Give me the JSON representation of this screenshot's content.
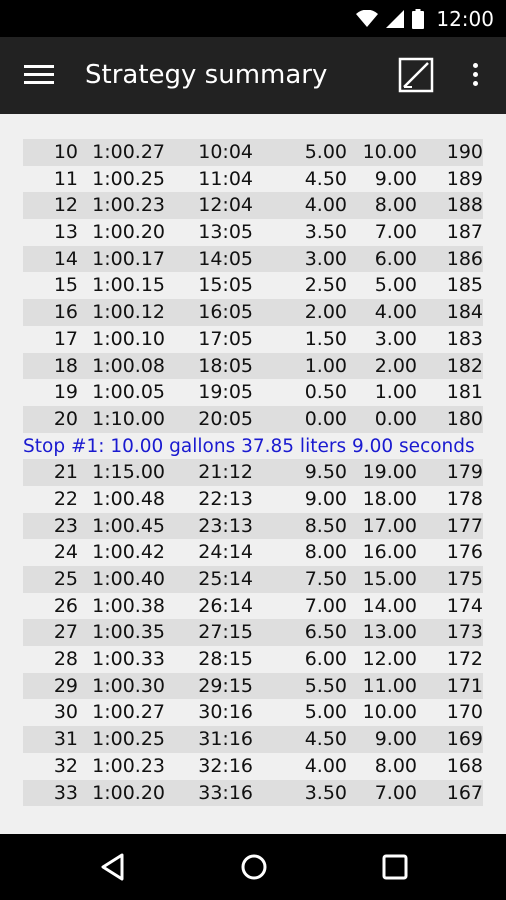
{
  "status_bar": {
    "time": "12:00"
  },
  "app_bar": {
    "title": "Strategy summary"
  },
  "table": {
    "groups": [
      {
        "rows": [
          [
            "10",
            "1:00.27",
            "10:04",
            "5.00",
            "10.00",
            "190"
          ],
          [
            "11",
            "1:00.25",
            "11:04",
            "4.50",
            "9.00",
            "189"
          ],
          [
            "12",
            "1:00.23",
            "12:04",
            "4.00",
            "8.00",
            "188"
          ],
          [
            "13",
            "1:00.20",
            "13:05",
            "3.50",
            "7.00",
            "187"
          ],
          [
            "14",
            "1:00.17",
            "14:05",
            "3.00",
            "6.00",
            "186"
          ],
          [
            "15",
            "1:00.15",
            "15:05",
            "2.50",
            "5.00",
            "185"
          ],
          [
            "16",
            "1:00.12",
            "16:05",
            "2.00",
            "4.00",
            "184"
          ],
          [
            "17",
            "1:00.10",
            "17:05",
            "1.50",
            "3.00",
            "183"
          ],
          [
            "18",
            "1:00.08",
            "18:05",
            "1.00",
            "2.00",
            "182"
          ],
          [
            "19",
            "1:00.05",
            "19:05",
            "0.50",
            "1.00",
            "181"
          ],
          [
            "20",
            "1:10.00",
            "20:05",
            "0.00",
            "0.00",
            "180"
          ]
        ]
      },
      {
        "stop_text": "Stop #1: 10.00 gallons 37.85 liters 9.00 seconds",
        "rows": [
          [
            "21",
            "1:15.00",
            "21:12",
            "9.50",
            "19.00",
            "179"
          ],
          [
            "22",
            "1:00.48",
            "22:13",
            "9.00",
            "18.00",
            "178"
          ],
          [
            "23",
            "1:00.45",
            "23:13",
            "8.50",
            "17.00",
            "177"
          ],
          [
            "24",
            "1:00.42",
            "24:14",
            "8.00",
            "16.00",
            "176"
          ],
          [
            "25",
            "1:00.40",
            "25:14",
            "7.50",
            "15.00",
            "175"
          ],
          [
            "26",
            "1:00.38",
            "26:14",
            "7.00",
            "14.00",
            "174"
          ],
          [
            "27",
            "1:00.35",
            "27:15",
            "6.50",
            "13.00",
            "173"
          ],
          [
            "28",
            "1:00.33",
            "28:15",
            "6.00",
            "12.00",
            "172"
          ],
          [
            "29",
            "1:00.30",
            "29:15",
            "5.50",
            "11.00",
            "171"
          ],
          [
            "30",
            "1:00.27",
            "30:16",
            "5.00",
            "10.00",
            "170"
          ],
          [
            "31",
            "1:00.25",
            "31:16",
            "4.50",
            "9.00",
            "169"
          ],
          [
            "32",
            "1:00.23",
            "32:16",
            "4.00",
            "8.00",
            "168"
          ],
          [
            "33",
            "1:00.20",
            "33:16",
            "3.50",
            "7.00",
            "167"
          ]
        ]
      }
    ]
  },
  "colors": {
    "app_bar": "#222222",
    "row_shade": "#dedede",
    "stop_text": "#1a1ad0",
    "background": "#f0f0f0"
  },
  "icons": {
    "menu": "hamburger-menu-icon",
    "edit": "edit-square-icon",
    "more": "more-vert-icon",
    "back": "back-triangle-icon",
    "home": "home-circle-icon",
    "recent": "recent-square-icon"
  }
}
